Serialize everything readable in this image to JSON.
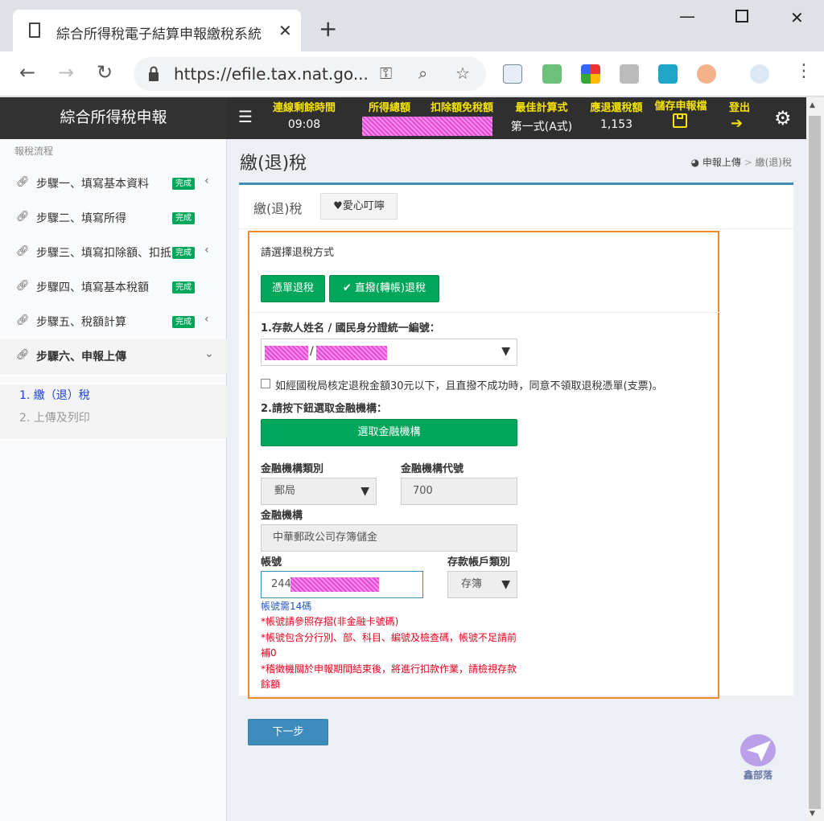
{
  "browser": {
    "tab_title": "綜合所得稅電子結算申報繳稅系統",
    "url": "https://efile.tax.nat.go...",
    "new_tab": "+",
    "close_tab": "✕"
  },
  "header": {
    "brand": "綜合所得稅申報",
    "countdown_label": "連線剩餘時間",
    "countdown_value": "09:08",
    "income_label": "所得總額",
    "deduction_label": "扣除額免稅額",
    "best_formula_label": "最佳計算式",
    "best_formula_value": "第一式(A式)",
    "refund_label": "應退還稅額",
    "refund_value": "1,153",
    "save_label": "儲存申報檔",
    "logout_label": "登出"
  },
  "sidebar": {
    "header": "報稅流程",
    "steps": [
      {
        "label": "步驟一、填寫基本資料",
        "badge": "完成",
        "chevron": "‹"
      },
      {
        "label": "步驟二、填寫所得",
        "badge": "完成",
        "chevron": ""
      },
      {
        "label": "步驟三、填寫扣除額、扣抵",
        "badge": "完成",
        "chevron": "‹"
      },
      {
        "label": "步驟四、填寫基本稅額",
        "badge": "完成",
        "chevron": ""
      },
      {
        "label": "步驟五、稅額計算",
        "badge": "完成",
        "chevron": "‹"
      },
      {
        "label": "步驟六、申報上傳",
        "badge": "",
        "chevron": "⌄"
      }
    ],
    "sub_items": [
      "1. 繳（退）稅",
      "2. 上傳及列印"
    ]
  },
  "main": {
    "title": "繳(退)稅",
    "breadcrumb_home": "申報上傳",
    "breadcrumb_sep": ">",
    "breadcrumb_current": "繳(退)稅",
    "tab_active": "繳(退)稅",
    "tab_other": "♥愛心叮嚀",
    "section_label": "請選擇退稅方式",
    "btn_voucher": "憑單退稅",
    "btn_direct": "✔ 直撥(轉帳)退稅",
    "q1_label": "1.存款人姓名 / 國民身分證統一編號：",
    "q1_separator": "/",
    "checkbox_label": "如經國稅局核定退稅金額30元以下，且直撥不成功時，同意不領取退稅憑單(支票)。",
    "q2_label": "2.請按下鈕選取金融機構：",
    "btn_select_bank": "選取金融機構",
    "bank_type_label": "金融機構類別",
    "bank_type_value": "郵局",
    "bank_code_label": "金融機構代號",
    "bank_code_value": "700",
    "bank_label": "金融機構",
    "bank_value": "中華郵政公司存簿儲金",
    "account_label": "帳號",
    "account_value": "244",
    "account_type_label": "存款帳戶類別",
    "account_type_value": "存簿",
    "note_digits": "帳號需14碼",
    "note_1": "*帳號請參照存摺(非金融卡號碼)",
    "note_2": "*帳號包含分行別、部、科目、編號及檢查碼，帳號不足請前補0",
    "note_3": "*稽徵機關於申報期間結束後，將進行扣款作業，請檢視存款餘額",
    "btn_next": "下一步",
    "logo_text": "鑫部落"
  },
  "colors": {
    "accent_green": "#00a65a",
    "accent_blue": "#3c8dbc",
    "highlight_orange": "#f08a24",
    "header_yellow": "#f7e400",
    "note_red": "#e8001c",
    "note_blue": "#2255cc",
    "redaction_pink": "#ff66e0"
  }
}
